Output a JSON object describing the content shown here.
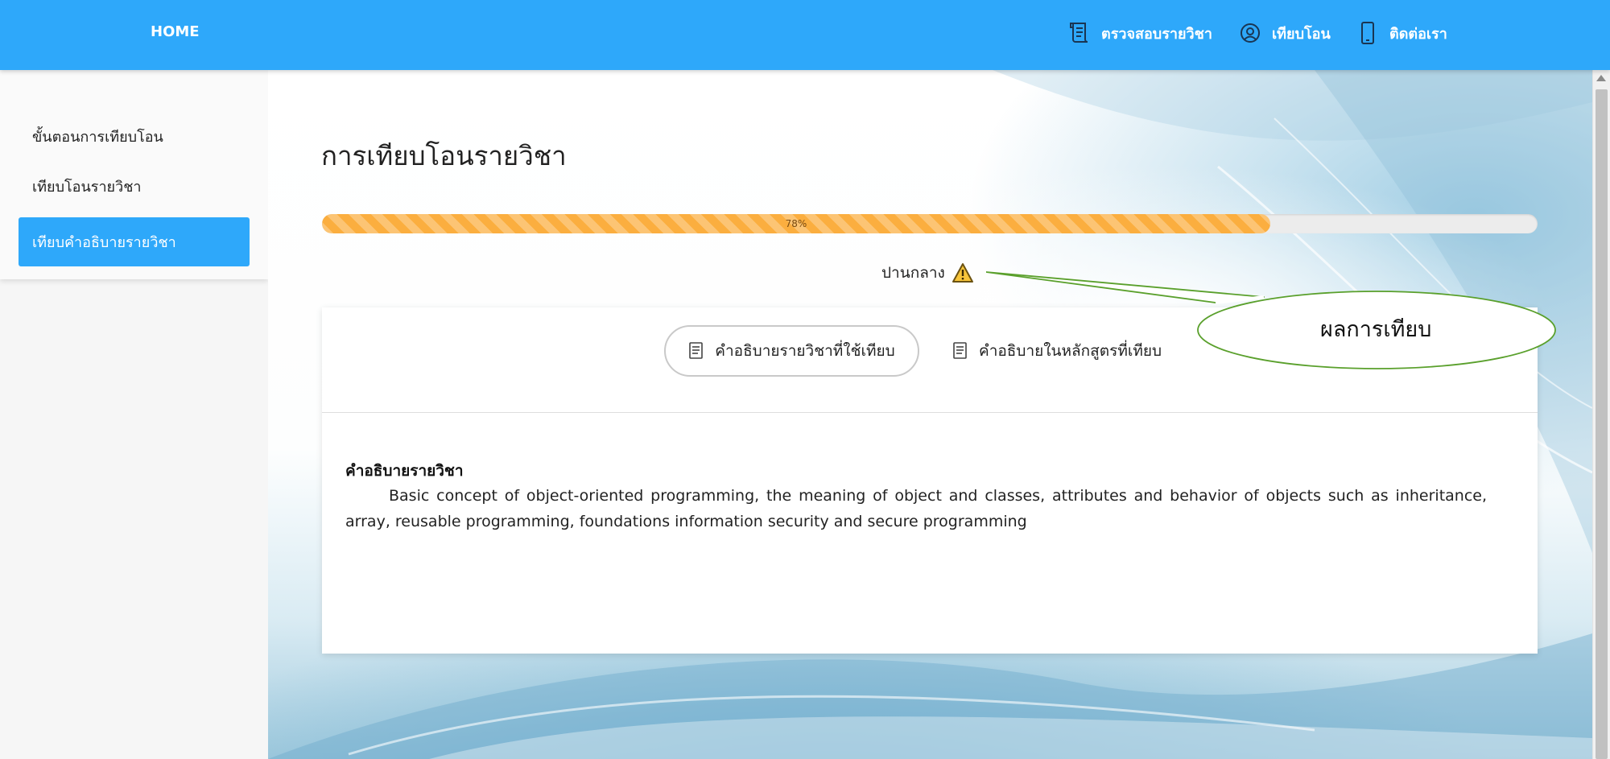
{
  "navbar": {
    "brand": "HOME",
    "links": [
      {
        "label": "ตรวจสอบรายวิชา",
        "icon": "scroll-icon"
      },
      {
        "label": "เทียบโอน",
        "icon": "user-circle-icon"
      },
      {
        "label": "ติดต่อเรา",
        "icon": "mobile-phone-icon"
      }
    ],
    "color": "#2ea8fa"
  },
  "sidebar": {
    "items": [
      {
        "label": "ขั้นตอนการเทียบโอน",
        "active": false
      },
      {
        "label": "เทียบโอนรายวิชา",
        "active": false
      },
      {
        "label": "เทียบคำอธิบายรายวิชา",
        "active": true
      }
    ]
  },
  "main": {
    "title": "การเทียบโอนรายวิชา",
    "progress": {
      "value": 78,
      "label": "78%",
      "color": "#fbae3f"
    },
    "result": {
      "label": "ปานกลาง",
      "icon": "warning-icon"
    },
    "tabs": [
      {
        "label": "คำอธิบายรายวิชาที่ใช้เทียบ",
        "icon": "document-icon",
        "active": true
      },
      {
        "label": "คำอธิบายในหลักสูตรที่เทียบ",
        "icon": "document-icon",
        "active": false
      }
    ],
    "section_heading": "คำอธิบายรายวิชา",
    "description": "Basic concept of object-oriented programming, the meaning of object and classes, attributes and behavior of objects such as inheritance, array, reusable programming, foundations information security and secure programming"
  },
  "annotation": {
    "label": "ผลการเทียบ",
    "color": "#5aa02c"
  }
}
